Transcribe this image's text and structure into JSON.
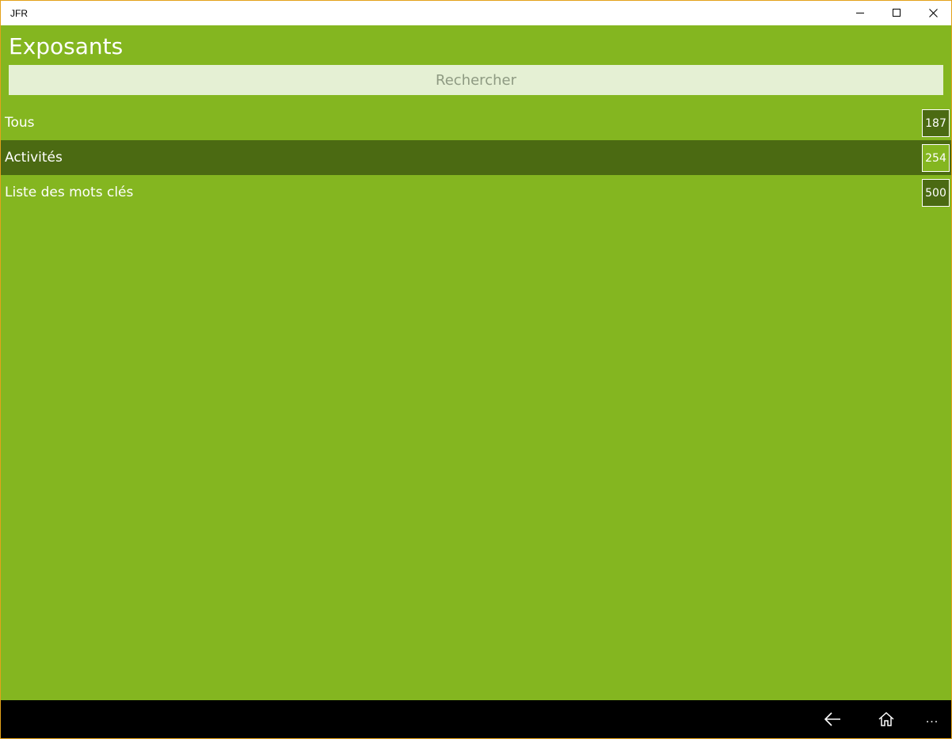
{
  "window": {
    "title": "JFR"
  },
  "page": {
    "title": "Exposants"
  },
  "search": {
    "placeholder": "Rechercher",
    "value": ""
  },
  "list": {
    "items": [
      {
        "label": "Tous",
        "count": "187",
        "selected": false
      },
      {
        "label": "Activités",
        "count": "254",
        "selected": true
      },
      {
        "label": "Liste des mots clés",
        "count": "500",
        "selected": false
      }
    ]
  },
  "appbar": {
    "back_icon": "arrow-left-icon",
    "home_icon": "home-icon",
    "more_label": "..."
  },
  "colors": {
    "background": "#84b620",
    "selected_row": "#4b6a12",
    "search_bg": "#e5f0d4",
    "appbar": "#000000",
    "window_border": "#e3a21a"
  }
}
